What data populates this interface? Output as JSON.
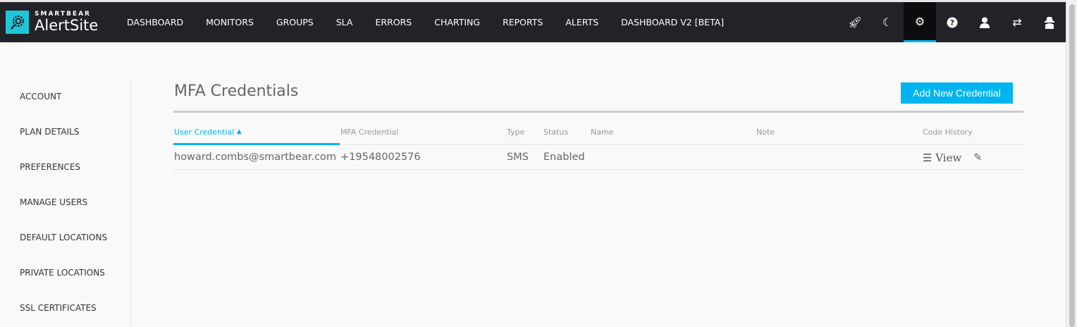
{
  "brand": {
    "small": "SMARTBEAR",
    "big": "AlertSite"
  },
  "nav": [
    "DASHBOARD",
    "MONITORS",
    "GROUPS",
    "SLA",
    "ERRORS",
    "CHARTING",
    "REPORTS",
    "ALERTS",
    "DASHBOARD V2 [BETA]"
  ],
  "sidebar": [
    "ACCOUNT",
    "PLAN DETAILS",
    "PREFERENCES",
    "MANAGE USERS",
    "DEFAULT LOCATIONS",
    "PRIVATE LOCATIONS",
    "SSL CERTIFICATES"
  ],
  "page": {
    "title": "MFA Credentials",
    "add_button": "Add New Credential"
  },
  "table": {
    "headers": [
      "User Credential",
      "MFA Credential",
      "Type",
      "Status",
      "Name",
      "Note",
      "Code History"
    ],
    "sort_indicator": "▲",
    "rows": [
      {
        "user": "howard.combs@smartbear.com",
        "mfa": "+19548002576",
        "type": "SMS",
        "status": "Enabled",
        "name": "",
        "note": "",
        "view": "View"
      }
    ]
  },
  "colors": {
    "accent": "#00b4f0",
    "nav_bg": "#222328"
  }
}
